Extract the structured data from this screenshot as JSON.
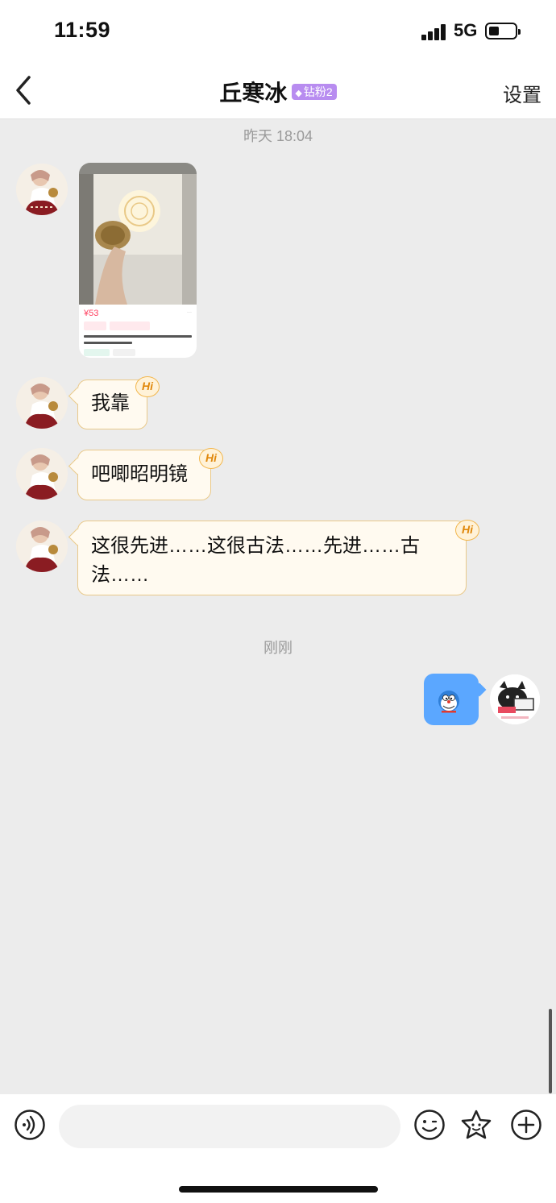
{
  "status_bar": {
    "time": "11:59",
    "network": "5G"
  },
  "header": {
    "title": "丘寒冰",
    "fan_badge": "钻粉2",
    "settings_label": "设置"
  },
  "timestamps": {
    "first": "昨天 18:04",
    "second": "刚刚"
  },
  "shared_card": {
    "price": "¥53"
  },
  "hi_badge_text": "Hi",
  "messages": [
    {
      "sender": "丘寒冰",
      "text": "我靠"
    },
    {
      "sender": "丘寒冰",
      "text": "吧唧昭明镜"
    },
    {
      "sender": "丘寒冰",
      "text": "这很先进……这很古法……先进……古法……"
    }
  ],
  "input": {
    "placeholder": ""
  },
  "colors": {
    "incoming_bubble": "#fffaf0",
    "bubble_border": "#e9c98a",
    "outgoing_bubble": "#5ba7ff",
    "fan_badge": "#b88cf0",
    "background": "#ececec"
  }
}
